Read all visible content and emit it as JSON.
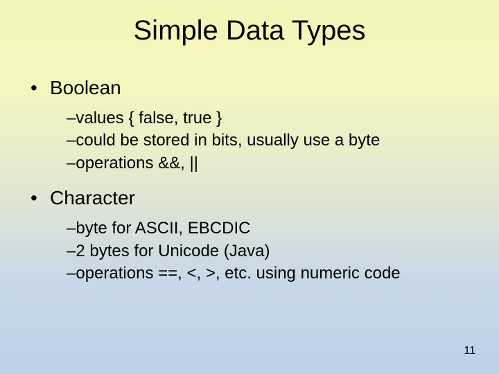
{
  "title": "Simple Data Types",
  "sections": [
    {
      "heading": "Boolean",
      "items": [
        "values { false, true }",
        "could be stored in bits, usually use a byte",
        "operations &&, ||"
      ]
    },
    {
      "heading": "Character",
      "items": [
        "byte for ASCII, EBCDIC",
        "2 bytes for Unicode (Java)",
        "operations  ==, <, >, etc. using numeric code"
      ]
    }
  ],
  "page_number": "11"
}
